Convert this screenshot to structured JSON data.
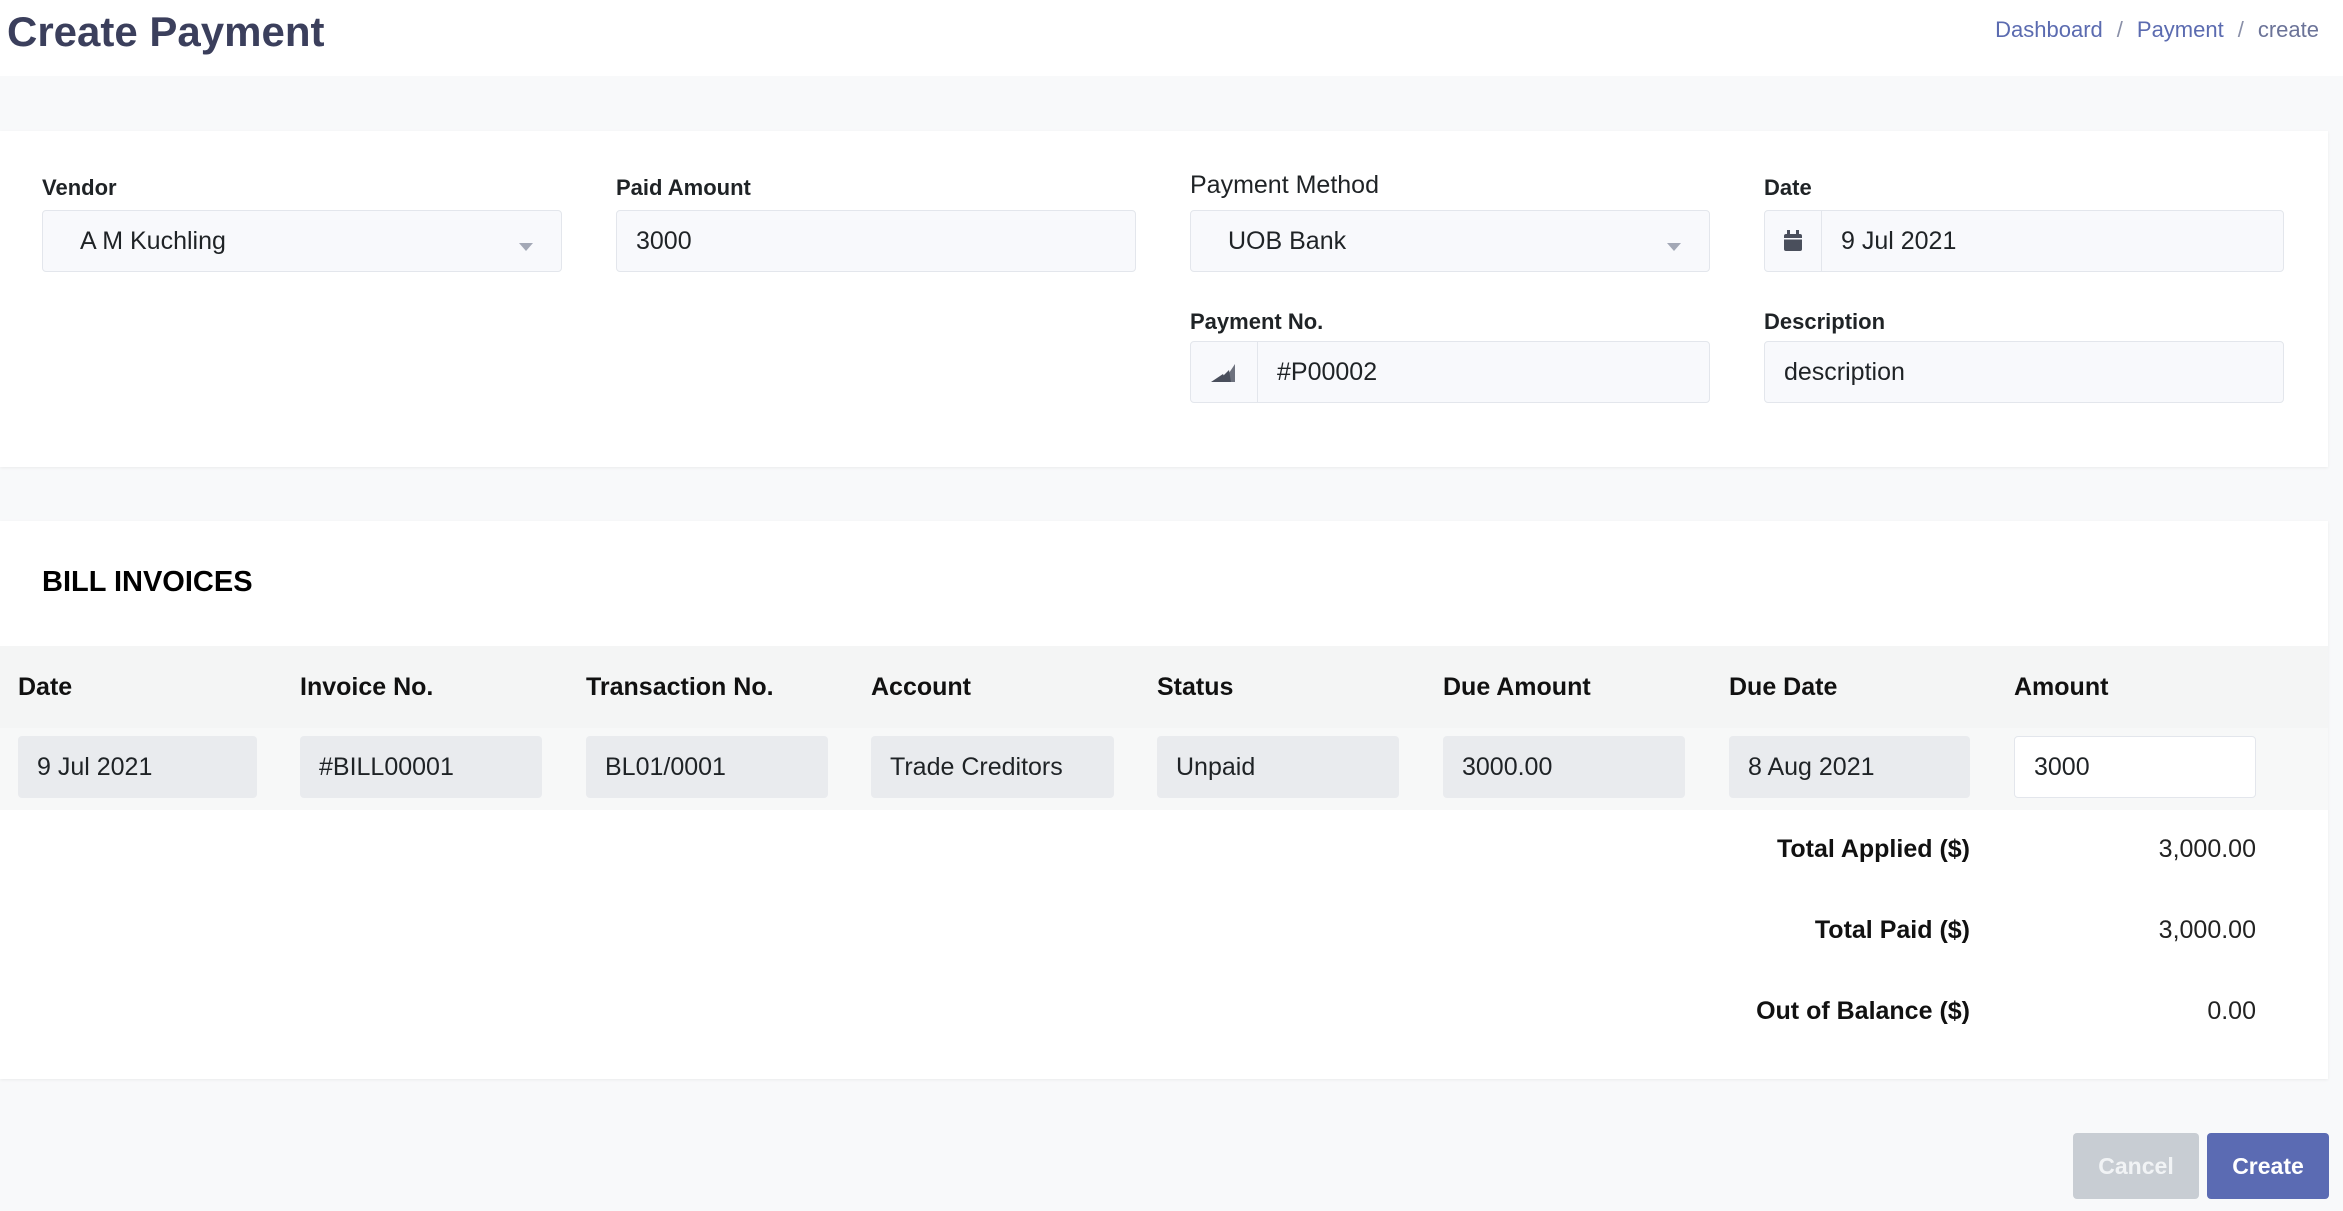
{
  "header": {
    "title": "Create Payment",
    "breadcrumb": [
      "Dashboard",
      "Payment",
      "create"
    ],
    "separator": "/"
  },
  "form": {
    "vendor": {
      "label": "Vendor",
      "value": "A M Kuchling"
    },
    "paid_amount": {
      "label": "Paid Amount",
      "value": "3000"
    },
    "payment_method": {
      "label": "Payment Method",
      "value": "UOB Bank"
    },
    "date": {
      "label": "Date",
      "value": "9 Jul 2021",
      "icon": "calendar-icon"
    },
    "payment_no": {
      "label": "Payment No.",
      "value": "#P00002",
      "icon": "hashtag-icon"
    },
    "description": {
      "label": "Description",
      "value": "description"
    }
  },
  "bill_invoices": {
    "title": "BILL INVOICES",
    "columns": [
      "Date",
      "Invoice No.",
      "Transaction No.",
      "Account",
      "Status",
      "Due Amount",
      "Due Date",
      "Amount"
    ],
    "rows": [
      [
        "9 Jul 2021",
        "#BILL00001",
        "BL01/0001",
        "Trade Creditors",
        "Unpaid",
        "3000.00",
        "8 Aug 2021",
        "3000"
      ]
    ],
    "totals": [
      {
        "label": "Total Applied ($)",
        "value": "3,000.00"
      },
      {
        "label": "Total Paid ($)",
        "value": "3,000.00"
      },
      {
        "label": "Out of Balance ($)",
        "value": "0.00"
      }
    ]
  },
  "actions": {
    "cancel": "Cancel",
    "create": "Create"
  },
  "colors": {
    "title": "#3b3f5c",
    "primary": "#5b6bb3",
    "cancel": "#c8cdd3"
  }
}
